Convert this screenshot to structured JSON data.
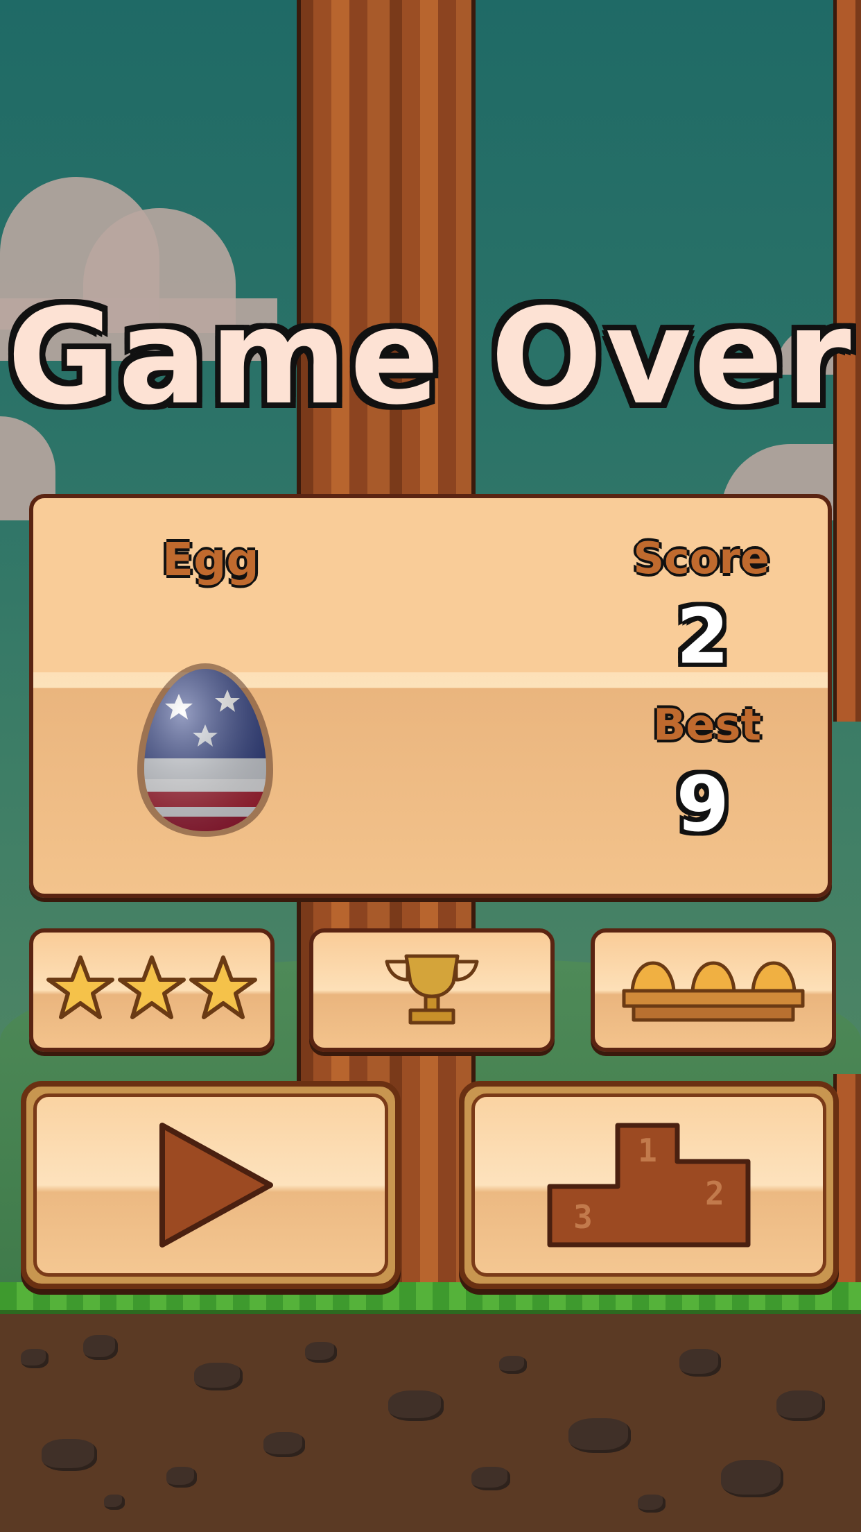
{
  "title": "Game Over",
  "panel": {
    "egg_label": "Egg",
    "score_label": "Score",
    "score_value": "2",
    "best_label": "Best",
    "best_value": "9",
    "egg_icon": "american-flag-egg"
  },
  "buttons": {
    "rate": {
      "icon": "three-stars-icon"
    },
    "achievements": {
      "icon": "trophy-icon"
    },
    "eggs": {
      "icon": "egg-carton-icon"
    },
    "play": {
      "icon": "play-triangle-icon"
    },
    "leaderboard": {
      "icon": "podium-icon",
      "podium_numbers": [
        "1",
        "2",
        "3"
      ]
    }
  },
  "colors": {
    "panel": "#f9cc98",
    "outline": "#5a2412",
    "label": "#c06a2e",
    "title": "#fde2d4",
    "icon_brown": "#9c4a22"
  }
}
